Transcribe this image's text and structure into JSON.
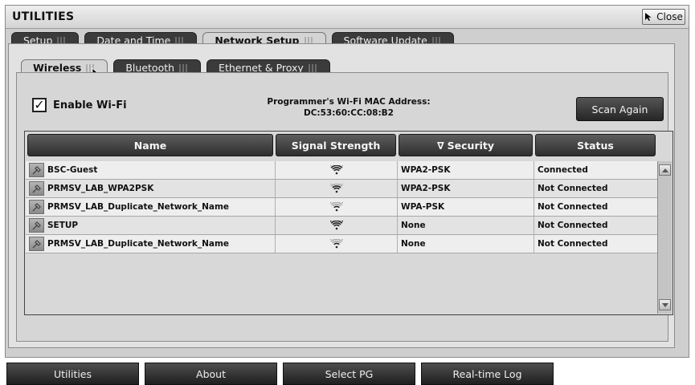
{
  "window": {
    "title": "UTILITIES",
    "close_label": "Close"
  },
  "main_tabs": [
    {
      "label": "Setup",
      "active": false
    },
    {
      "label": "Date and Time",
      "active": false
    },
    {
      "label": "Network Setup",
      "active": true
    },
    {
      "label": "Software Update",
      "active": false
    }
  ],
  "sub_tabs": [
    {
      "label": "Wireless",
      "active": true
    },
    {
      "label": "Bluetooth",
      "active": false
    },
    {
      "label": "Ethernet & Proxy",
      "active": false
    }
  ],
  "wifi": {
    "enable_label": "Enable Wi-Fi",
    "enabled": true,
    "check_mark": "✓",
    "mac_label": "Programmer's Wi-Fi MAC Address:",
    "mac_value": "DC:53:60:CC:08:B2",
    "scan_label": "Scan Again"
  },
  "table": {
    "headers": {
      "name": "Name",
      "signal": "Signal Strength",
      "security": "Security",
      "status": "Status"
    },
    "sort_indicator": "∇",
    "rows": [
      {
        "name": "BSC-Guest",
        "signal_bars": 3,
        "security": "WPA2-PSK",
        "status": "Connected"
      },
      {
        "name": "PRMSV_LAB_WPA2PSK",
        "signal_bars": 2,
        "security": "WPA2-PSK",
        "status": "Not Connected"
      },
      {
        "name": "PRMSV_LAB_Duplicate_Network_Name",
        "signal_bars": 1,
        "security": "WPA-PSK",
        "status": "Not Connected"
      },
      {
        "name": "SETUP",
        "signal_bars": 4,
        "security": "None",
        "status": "Not Connected"
      },
      {
        "name": "PRMSV_LAB_Duplicate_Network_Name",
        "signal_bars": 1,
        "security": "None",
        "status": "Not Connected"
      }
    ]
  },
  "bottom_nav": [
    {
      "label": "Utilities"
    },
    {
      "label": "About"
    },
    {
      "label": "Select PG"
    },
    {
      "label": "Real-time Log"
    }
  ],
  "icons": {
    "close": "cursor-arrow-icon",
    "network": "network-item-icon",
    "signal": "wifi-signal-icon",
    "scroll_up": "scroll-up-arrow-icon",
    "scroll_down": "scroll-down-arrow-icon"
  },
  "colors": {
    "window_bg": "#cfcfcf",
    "dark_button": "#2e2e2e",
    "active_tab": "#d4d4d4"
  }
}
